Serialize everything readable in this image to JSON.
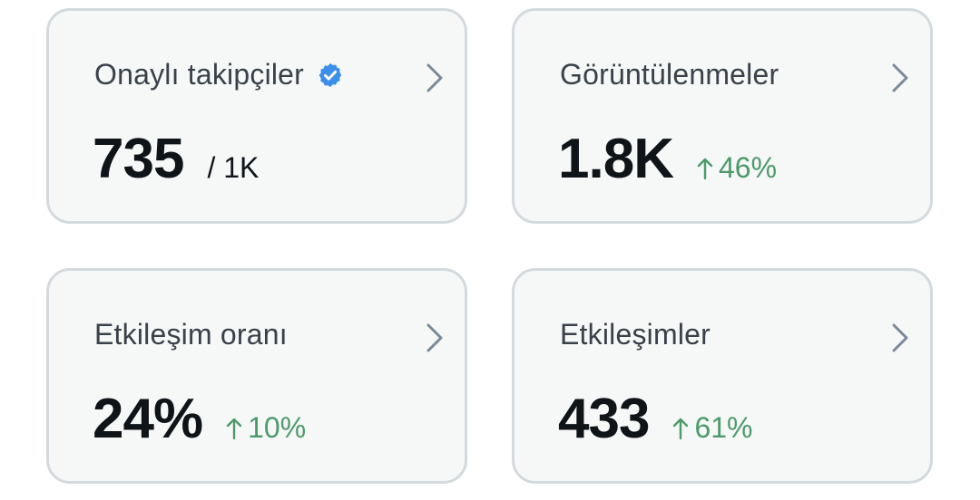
{
  "cards": [
    {
      "title": "Onaylı takipçiler",
      "value": "735",
      "suffix": "/ 1K",
      "icon": "verified-badge-icon"
    },
    {
      "title": "Görüntülenmeler",
      "value": "1.8K",
      "delta": "46%",
      "delta_direction": "up"
    },
    {
      "title": "Etkileşim oranı",
      "value": "24%",
      "delta": "10%",
      "delta_direction": "up"
    },
    {
      "title": "Etkileşimler",
      "value": "433",
      "delta": "61%",
      "delta_direction": "up"
    }
  ],
  "colors": {
    "card_background": "#f6f8f8",
    "card_border": "#d3dadd",
    "positive_delta": "#4c9a6a",
    "verified_badge": "#3b8fe8",
    "chevron": "#7a8a99"
  }
}
